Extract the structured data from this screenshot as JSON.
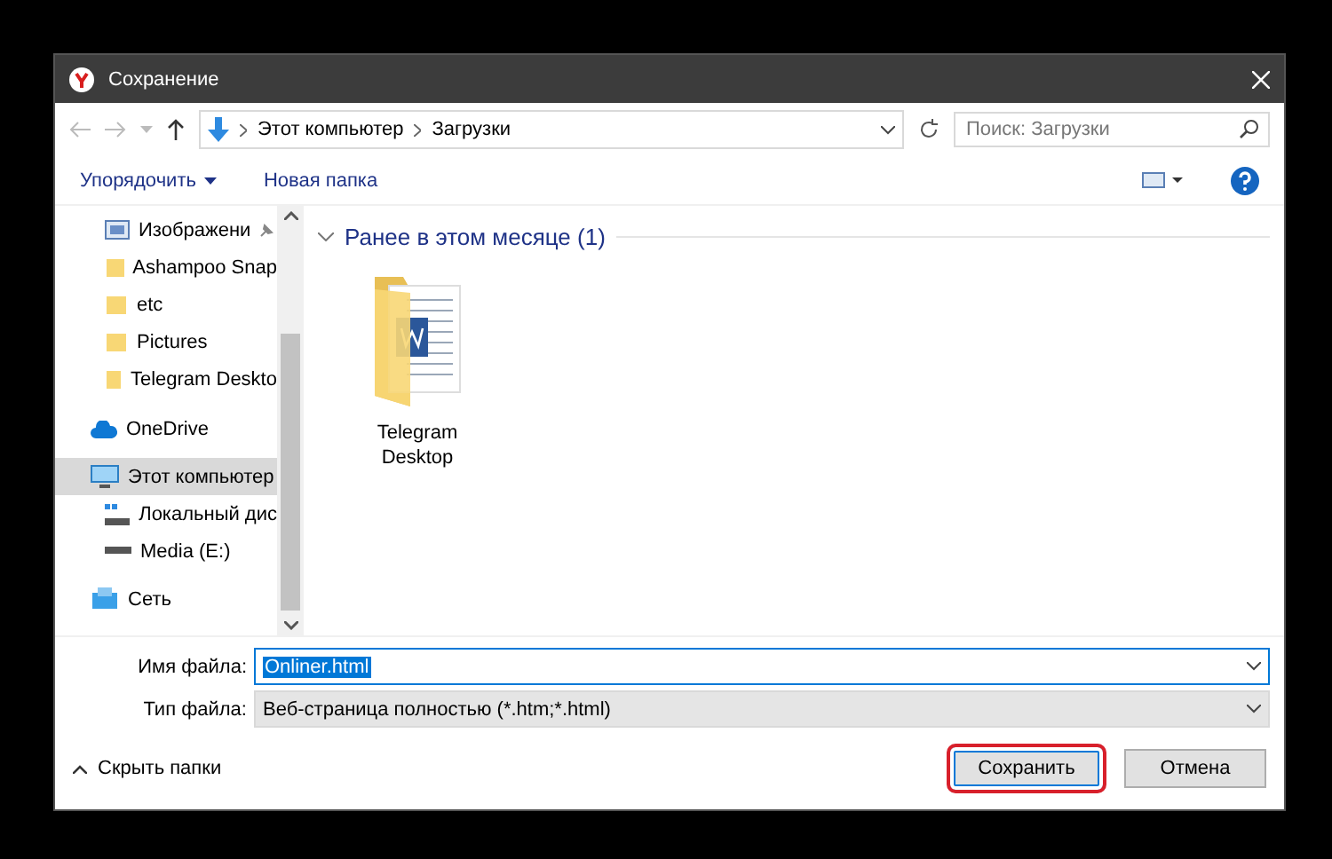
{
  "window": {
    "title": "Сохранение"
  },
  "nav": {
    "path": [
      "Этот компьютер",
      "Загрузки"
    ],
    "search_placeholder": "Поиск: Загрузки"
  },
  "toolbar": {
    "organize": "Упорядочить",
    "new_folder": "Новая папка"
  },
  "sidebar": {
    "quick_access": [
      {
        "label": "Изображени",
        "kind": "pictures",
        "pinned": true,
        "selected": false
      },
      {
        "label": "Ashampoo Snap",
        "kind": "folder",
        "pinned": false,
        "selected": false
      },
      {
        "label": "etc",
        "kind": "folder",
        "pinned": false,
        "selected": false
      },
      {
        "label": "Pictures",
        "kind": "folder",
        "pinned": false,
        "selected": false
      },
      {
        "label": "Telegram Deskto",
        "kind": "folder",
        "pinned": false,
        "selected": false
      }
    ],
    "items": [
      {
        "label": "OneDrive",
        "kind": "cloud",
        "selected": false
      },
      {
        "label": "Этот компьютер",
        "kind": "computer",
        "selected": true,
        "children": [
          {
            "label": "Локальный дис",
            "kind": "system-drive",
            "selected": false
          },
          {
            "label": "Media (E:)",
            "kind": "drive",
            "selected": false
          }
        ]
      },
      {
        "label": "Сеть",
        "kind": "network",
        "selected": false
      }
    ]
  },
  "group": {
    "title": "Ранее в этом месяце (1)",
    "expanded": true,
    "files": [
      {
        "name": "Telegram Desktop",
        "kind": "word-folder"
      }
    ]
  },
  "form": {
    "filename_label": "Имя файла:",
    "filename": "Onliner.html",
    "filetype_label": "Тип файла:",
    "filetype": "Веб-страница полностью (*.htm;*.html)"
  },
  "footer": {
    "hide_folders": "Скрыть папки",
    "buttons": [
      {
        "label": "Сохранить",
        "kind": "primary",
        "highlighted": true
      },
      {
        "label": "Отмена",
        "kind": "normal",
        "highlighted": false
      }
    ]
  }
}
